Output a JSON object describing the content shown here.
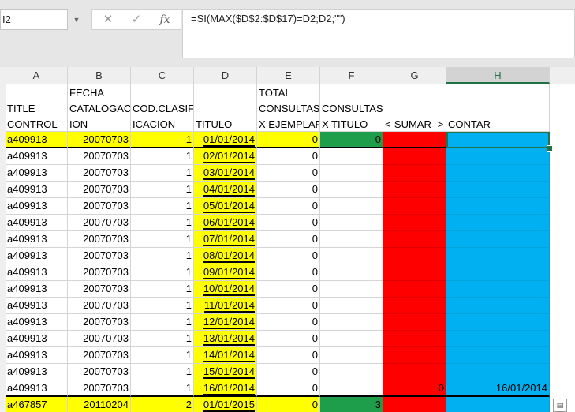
{
  "name_box": "I2",
  "formula_bar": {
    "cancel_icon": "✕",
    "enter_icon": "✓",
    "fx_label": "fx",
    "formula": "=SI(MAX($D$2:$D$17)=D2;D2;\"\")"
  },
  "columns": [
    "A",
    "B",
    "C",
    "D",
    "E",
    "F",
    "G",
    "H"
  ],
  "headers": {
    "A": [
      "",
      "TITLE",
      "CONTROL"
    ],
    "B": [
      "FECHA",
      "CATALOGAC",
      "ION"
    ],
    "C": [
      "",
      "COD.CLASIF",
      "ICACION"
    ],
    "D": [
      "",
      "",
      "TITULO"
    ],
    "E": [
      "TOTAL",
      "CONSULTAS",
      "X EJEMPLAR"
    ],
    "F": [
      "",
      "CONSULTAS",
      "X TITULO"
    ],
    "G": [
      "",
      "",
      "<-SUMAR ->"
    ],
    "H": [
      "",
      "",
      "CONTAR"
    ]
  },
  "rows": [
    {
      "a": "a409913",
      "b": "20070703",
      "c": "1",
      "d": "01/01/2014",
      "e": "0",
      "f": "0",
      "g": "",
      "h": ""
    },
    {
      "a": "a409913",
      "b": "20070703",
      "c": "1",
      "d": "02/01/2014",
      "e": "0",
      "f": "",
      "g": "",
      "h": ""
    },
    {
      "a": "a409913",
      "b": "20070703",
      "c": "1",
      "d": "03/01/2014",
      "e": "0",
      "f": "",
      "g": "",
      "h": ""
    },
    {
      "a": "a409913",
      "b": "20070703",
      "c": "1",
      "d": "04/01/2014",
      "e": "0",
      "f": "",
      "g": "",
      "h": ""
    },
    {
      "a": "a409913",
      "b": "20070703",
      "c": "1",
      "d": "05/01/2014",
      "e": "0",
      "f": "",
      "g": "",
      "h": ""
    },
    {
      "a": "a409913",
      "b": "20070703",
      "c": "1",
      "d": "06/01/2014",
      "e": "0",
      "f": "",
      "g": "",
      "h": ""
    },
    {
      "a": "a409913",
      "b": "20070703",
      "c": "1",
      "d": "07/01/2014",
      "e": "0",
      "f": "",
      "g": "",
      "h": ""
    },
    {
      "a": "a409913",
      "b": "20070703",
      "c": "1",
      "d": "08/01/2014",
      "e": "0",
      "f": "",
      "g": "",
      "h": ""
    },
    {
      "a": "a409913",
      "b": "20070703",
      "c": "1",
      "d": "09/01/2014",
      "e": "0",
      "f": "",
      "g": "",
      "h": ""
    },
    {
      "a": "a409913",
      "b": "20070703",
      "c": "1",
      "d": "10/01/2014",
      "e": "0",
      "f": "",
      "g": "",
      "h": ""
    },
    {
      "a": "a409913",
      "b": "20070703",
      "c": "1",
      "d": "11/01/2014",
      "e": "0",
      "f": "",
      "g": "",
      "h": ""
    },
    {
      "a": "a409913",
      "b": "20070703",
      "c": "1",
      "d": "12/01/2014",
      "e": "0",
      "f": "",
      "g": "",
      "h": ""
    },
    {
      "a": "a409913",
      "b": "20070703",
      "c": "1",
      "d": "13/01/2014",
      "e": "0",
      "f": "",
      "g": "",
      "h": ""
    },
    {
      "a": "a409913",
      "b": "20070703",
      "c": "1",
      "d": "14/01/2014",
      "e": "0",
      "f": "",
      "g": "",
      "h": ""
    },
    {
      "a": "a409913",
      "b": "20070703",
      "c": "1",
      "d": "15/01/2014",
      "e": "0",
      "f": "",
      "g": "",
      "h": ""
    },
    {
      "a": "a409913",
      "b": "20070703",
      "c": "1",
      "d": "16/01/2014",
      "e": "0",
      "f": "",
      "g": "0",
      "h": "16/01/2014"
    },
    {
      "a": "a467857",
      "b": "20110204",
      "c": "2",
      "d": "01/01/2015",
      "e": "0",
      "f": "3",
      "g": "",
      "h": ""
    }
  ],
  "colors": {
    "yellow": "#ffff00",
    "green": "#1e9e4a",
    "red": "#ff0000",
    "blue": "#00b0f0",
    "selection": "#217346"
  },
  "paste_options_icon": "paste-options-icon"
}
